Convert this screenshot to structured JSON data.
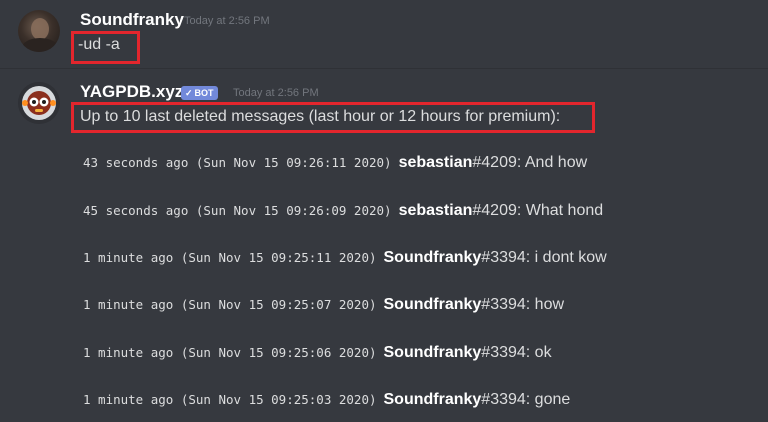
{
  "messages": {
    "user_message": {
      "author": "Soundfranky",
      "timestamp": "Today at 2:56 PM",
      "content": "-ud -a"
    },
    "bot_message": {
      "author": "YAGPDB.xyz",
      "badge": "BOT",
      "badge_check": "✓",
      "timestamp": "Today at 2:56 PM",
      "header": "Up to 10 last deleted messages (last hour or 12 hours for premium):",
      "entries": [
        {
          "time": "43 seconds ago (Sun Nov 15 09:26:11 2020)",
          "user": "sebastian",
          "rest": "#4209: And how"
        },
        {
          "time": "45 seconds ago (Sun Nov 15 09:26:09 2020)",
          "user": "sebastian",
          "rest": "#4209: What hond"
        },
        {
          "time": "1 minute ago (Sun Nov 15 09:25:11 2020)",
          "user": "Soundfranky",
          "rest": "#3394: i dont kow"
        },
        {
          "time": "1 minute ago (Sun Nov 15 09:25:07 2020)",
          "user": "Soundfranky",
          "rest": "#3394: how"
        },
        {
          "time": "1 minute ago (Sun Nov 15 09:25:06 2020)",
          "user": "Soundfranky",
          "rest": "#3394: ok"
        },
        {
          "time": "1 minute ago (Sun Nov 15 09:25:03 2020)",
          "user": "Soundfranky",
          "rest": "#3394: gone"
        }
      ]
    }
  },
  "colors": {
    "background": "#36393f",
    "username": "#ffffff",
    "text": "#dcddde",
    "timestamp": "#72767d",
    "bot_badge": "#7289da",
    "highlight": "#e3262d"
  }
}
